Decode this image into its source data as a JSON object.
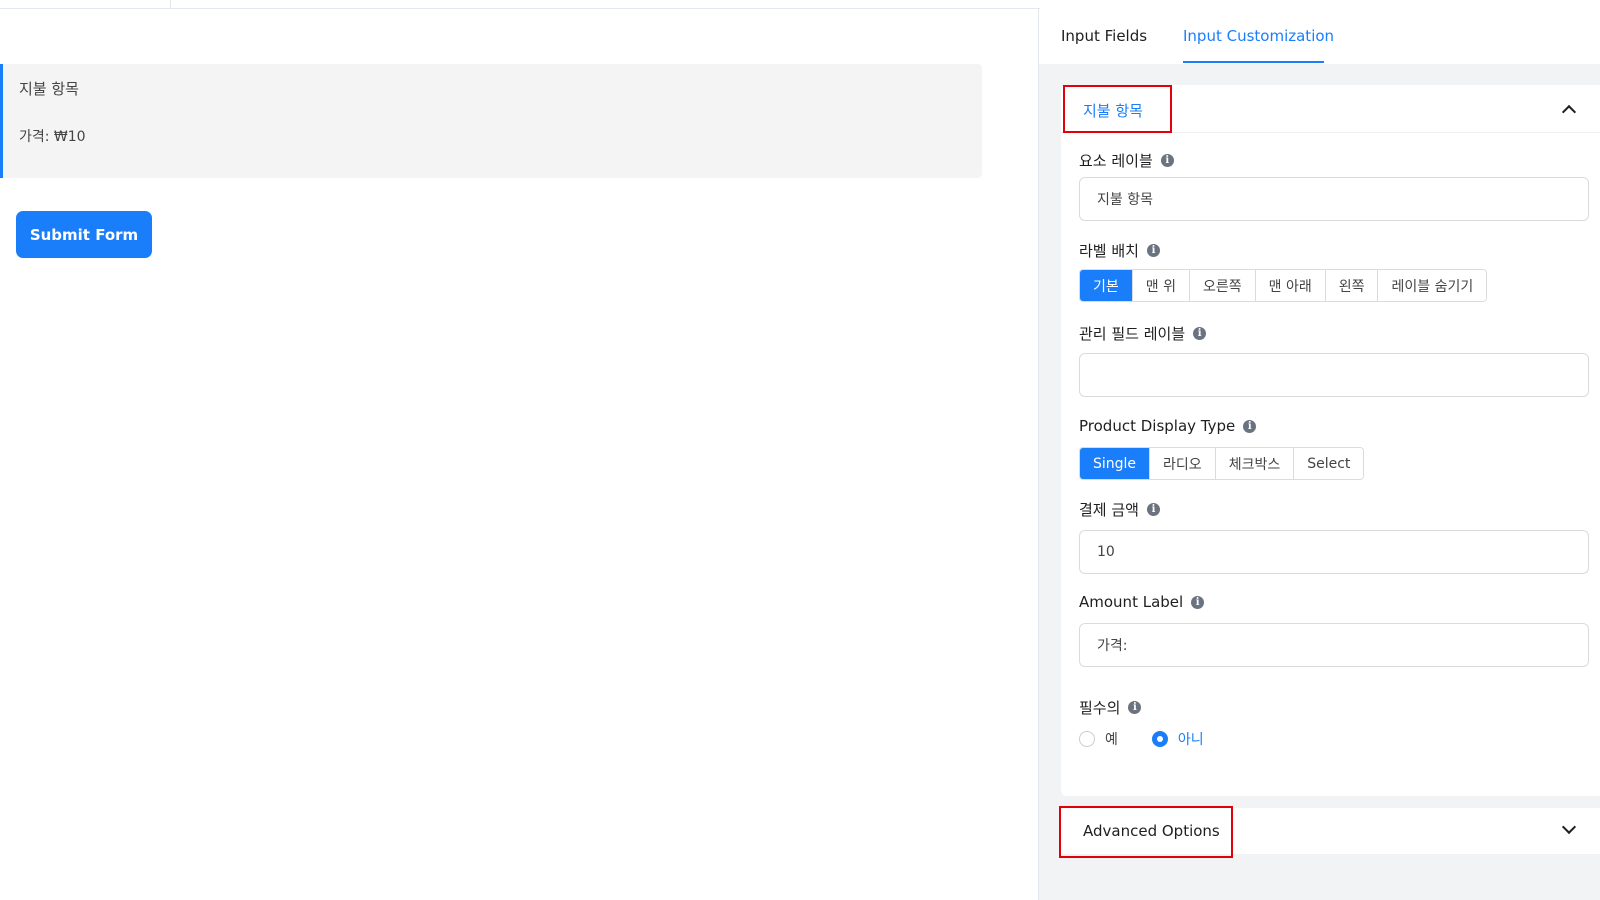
{
  "preview": {
    "field_label": "지불 항목",
    "price_text": "가격: ₩10",
    "submit_label": "Submit Form"
  },
  "sidebar": {
    "tabs": [
      {
        "label": "Input Fields",
        "active": false
      },
      {
        "label": "Input Customization",
        "active": true
      }
    ],
    "panel": {
      "title": "지불 항목",
      "element_label": {
        "label": "요소 레이블",
        "value": "지불 항목"
      },
      "label_placement": {
        "label": "라벨 배치",
        "options": [
          "기본",
          "맨 위",
          "오른쪽",
          "맨 아래",
          "왼쪽",
          "레이블 숨기기"
        ],
        "selected": "기본"
      },
      "admin_field_label": {
        "label": "관리 필드 레이블",
        "value": ""
      },
      "product_display_type": {
        "label": "Product Display Type",
        "options": [
          "Single",
          "라디오",
          "체크박스",
          "Select"
        ],
        "selected": "Single"
      },
      "payment_amount": {
        "label": "결제 금액",
        "value": "10"
      },
      "amount_label": {
        "label": "Amount Label",
        "value": "가격:"
      },
      "required": {
        "label": "필수의",
        "options": [
          "예",
          "아니"
        ],
        "selected": "아니"
      }
    },
    "advanced_options": {
      "title": "Advanced Options"
    }
  },
  "colors": {
    "accent": "#1a7efb",
    "highlight": "#e3000b",
    "sidebar_bg": "#f2f3f5",
    "preview_bg": "#f4f4f4"
  },
  "icons": [
    "info-icon",
    "chevron-up-icon",
    "chevron-down-icon"
  ]
}
